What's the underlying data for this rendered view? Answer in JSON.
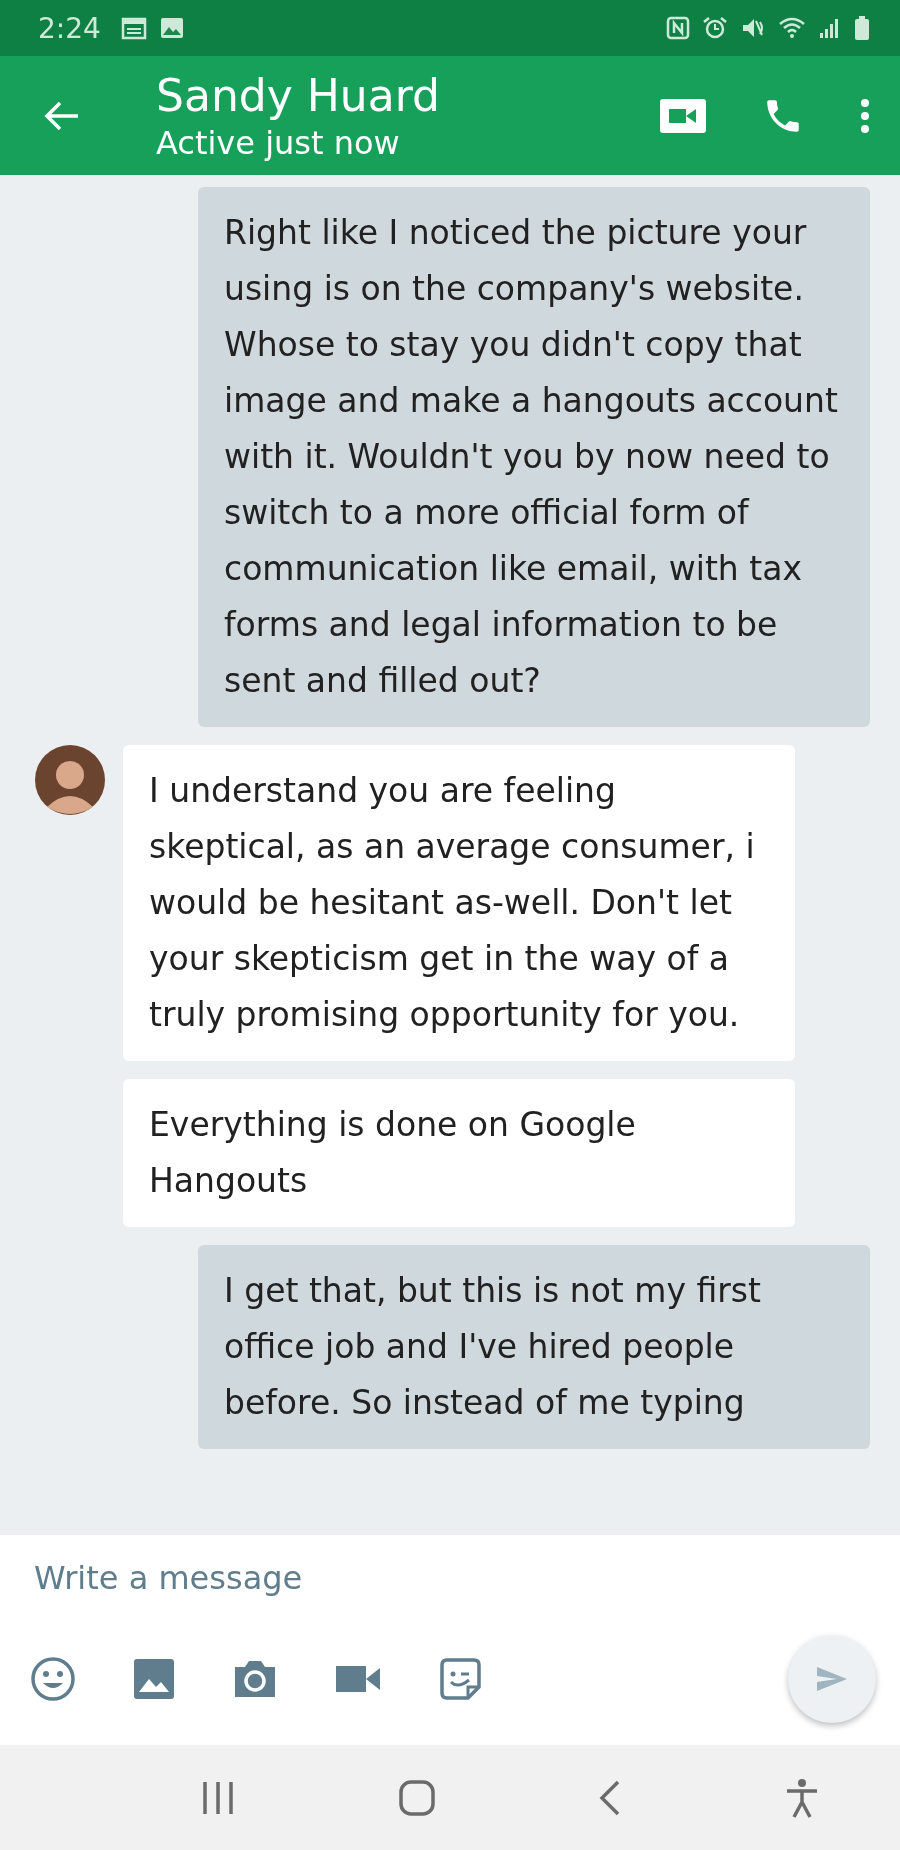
{
  "status_bar": {
    "time": "2:24"
  },
  "header": {
    "title": "Sandy Huard",
    "subtitle": "Active just now"
  },
  "messages": [
    {
      "kind": "sent",
      "text": "Right like I noticed the picture your using is on the company's website. Whose to stay you didn't copy that image and make a hangouts account with it. Wouldn't you by now need to switch to a more official form of communication like email, with tax forms and legal information to be sent and filled out?"
    },
    {
      "kind": "received",
      "avatar": true,
      "text": "I understand you are feeling skeptical, as an average consumer, i would be hesitant as-well. Don't let your skepticism get in the way of a truly promising opportunity for you."
    },
    {
      "kind": "received",
      "avatar": false,
      "text": "Everything is done on Google Hangouts"
    },
    {
      "kind": "sent",
      "text": "I get that,  but this is not my first office job and I've hired people before. So instead of me typing"
    }
  ],
  "composer": {
    "placeholder": "Write a message"
  }
}
